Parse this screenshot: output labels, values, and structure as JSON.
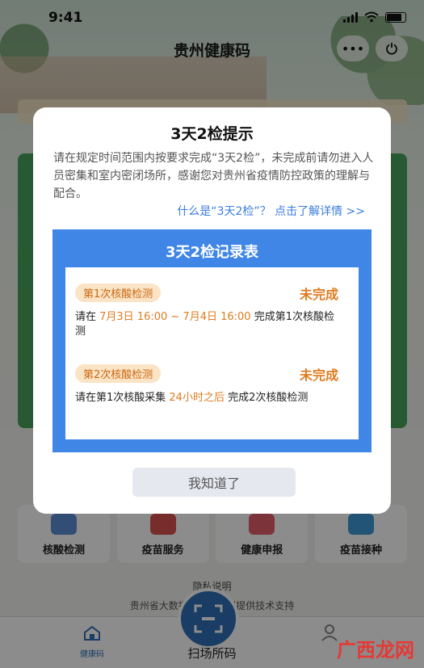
{
  "status": {
    "time": "9:41"
  },
  "app": {
    "title": "贵州健康码",
    "more_icon": "more-icon",
    "power_icon": "power-icon"
  },
  "grid": [
    {
      "label": "核酸检测",
      "icon": "nucleic-test-icon",
      "color": "#5b8fd6"
    },
    {
      "label": "疫苗服务",
      "icon": "vaccine-service-icon",
      "color": "#d9534f"
    },
    {
      "label": "健康申报",
      "icon": "health-report-icon",
      "color": "#e35d6a"
    },
    {
      "label": "疫苗接种",
      "icon": "vaccination-icon",
      "color": "#3f9ad6"
    }
  ],
  "footer": {
    "privacy": "隐私说明",
    "support": "贵州省大数据局统              · 贵州提供技术支持"
  },
  "tabbar": {
    "home_label": "健康码",
    "scan_label": "扫场所码"
  },
  "modal": {
    "title": "3天2检提示",
    "body": "请在规定时间范围内按要求完成“3天2检”，未完成前请勿进入人员密集和室内密闭场所，感谢您对贵州省疫情防控政策的理解与配合。",
    "link": "什么是“3天2检”？ 点击了解详情 >>",
    "record_title": "3天2检记录表",
    "items": [
      {
        "badge": "第1次核酸检测",
        "status": "未完成",
        "text_pre": "请在 ",
        "text_hl": "7月3日 16:00 ~ 7月4日 16:00",
        "text_post": " 完成第1次核酸检测"
      },
      {
        "badge": "第2次核酸检测",
        "status": "未完成",
        "text_pre": "请在第1次核酸采集 ",
        "text_hl": "24小时之后",
        "text_post": " 完成2次核酸检测"
      }
    ],
    "button": "我知道了"
  },
  "watermark": {
    "text": "广西龙网"
  },
  "colors": {
    "accent": "#3f86e6",
    "warning": "#e07b1f",
    "badge_bg": "#fbe3c6",
    "green": "#47a45b"
  }
}
